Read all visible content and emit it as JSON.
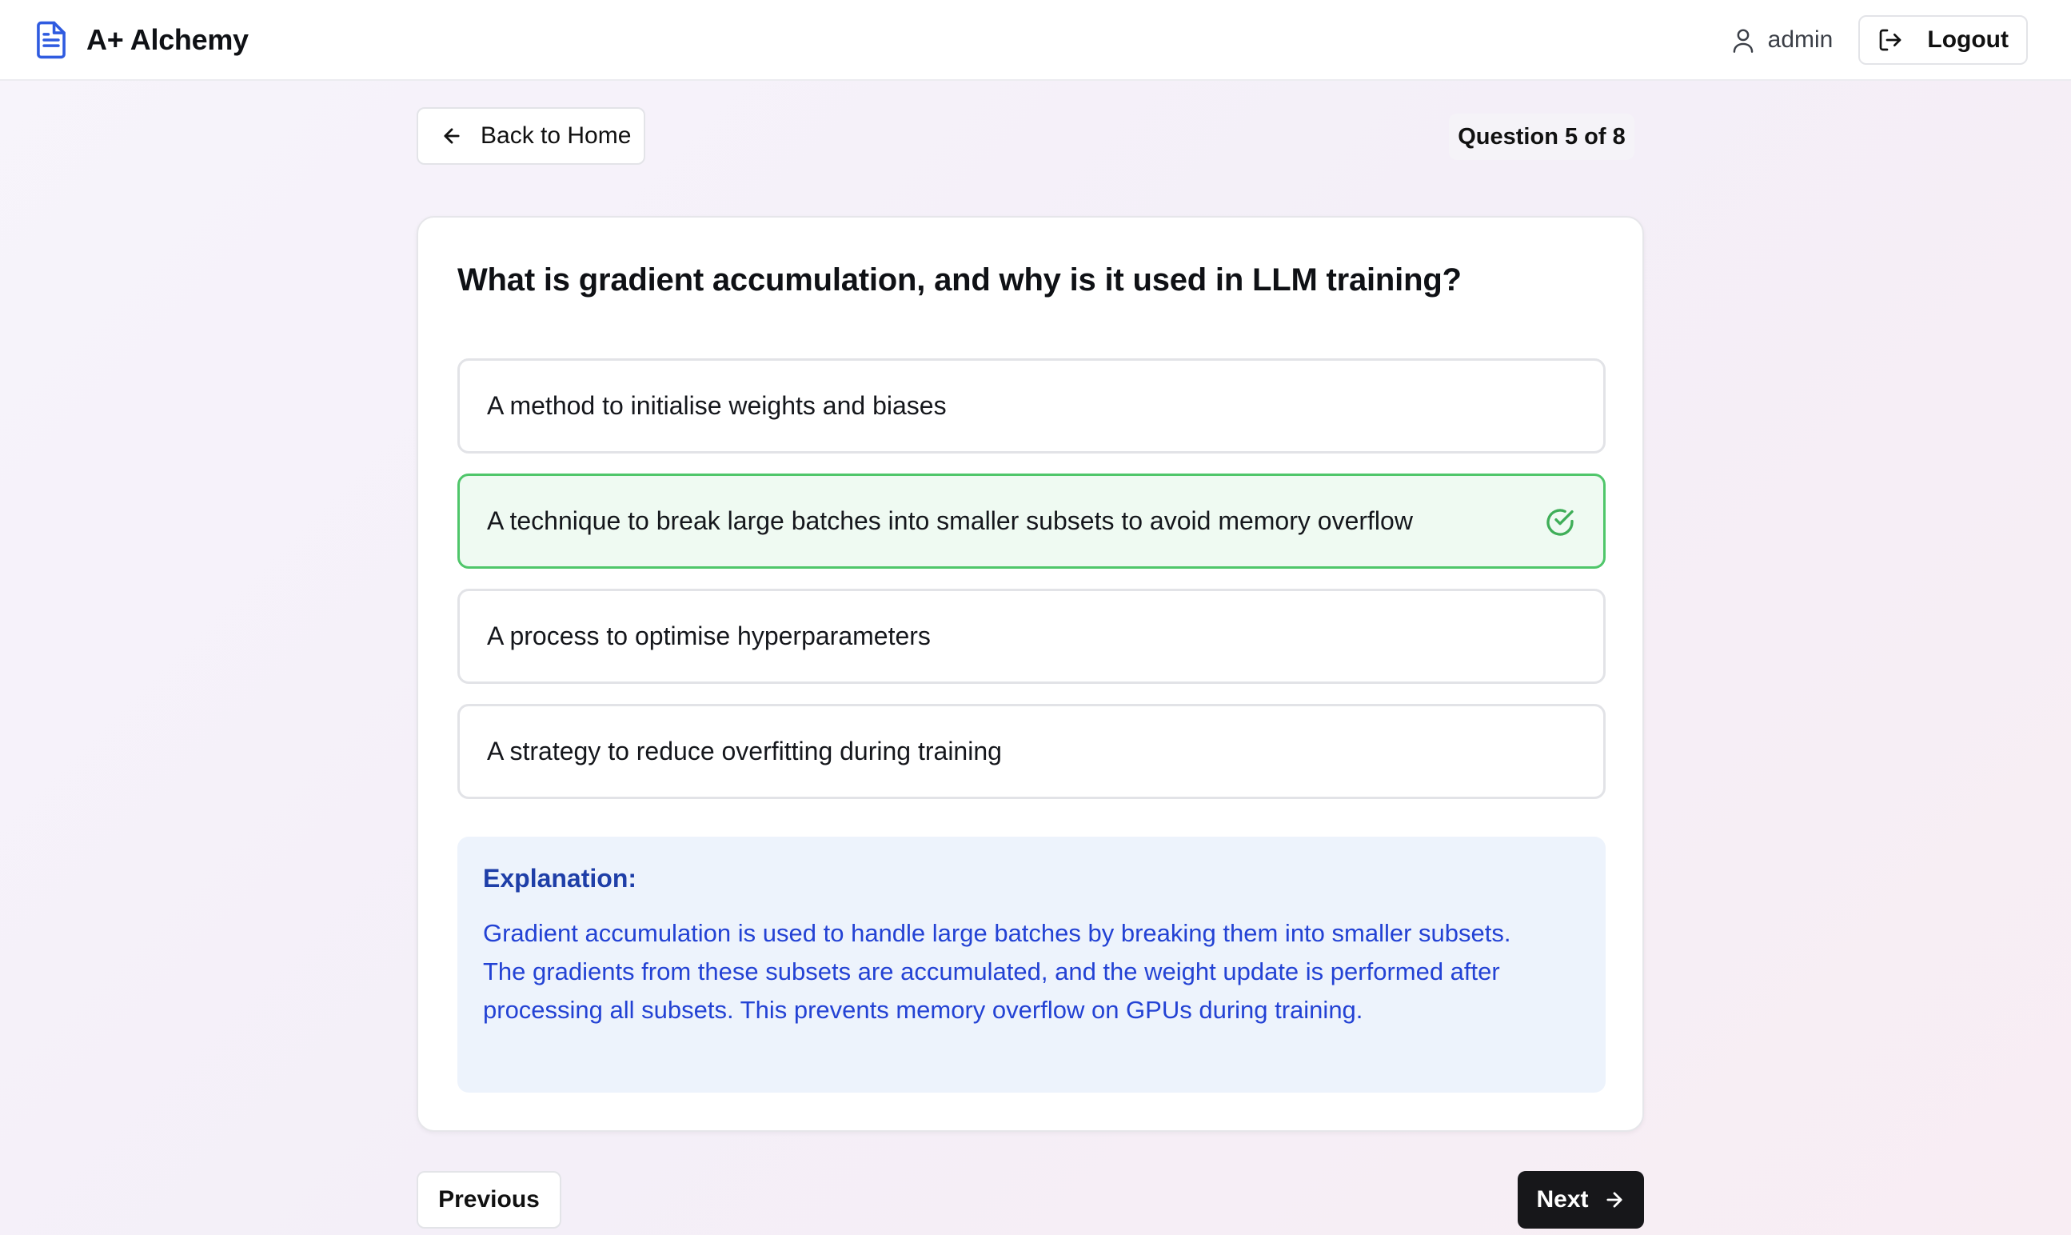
{
  "app": {
    "name": "A+ Alchemy"
  },
  "header": {
    "user": "admin",
    "logout_label": "Logout"
  },
  "nav": {
    "back_label": "Back to Home",
    "progress": "Question 5 of 8"
  },
  "quiz": {
    "question": "What is gradient accumulation, and why is it used in LLM training?",
    "options": [
      {
        "text": "A method to initialise weights and biases",
        "state": "default"
      },
      {
        "text": "A technique to break large batches into smaller subsets to avoid memory overflow",
        "state": "correct"
      },
      {
        "text": "A process to optimise hyperparameters",
        "state": "default"
      },
      {
        "text": "A strategy to reduce overfitting during training",
        "state": "default"
      }
    ],
    "explanation": {
      "title": "Explanation:",
      "text": "Gradient accumulation is used to handle large batches by breaking them into smaller subsets. The gradients from these subsets are accumulated, and the weight update is performed after processing all subsets. This prevents memory overflow on GPUs during training."
    }
  },
  "footer": {
    "previous_label": "Previous",
    "next_label": "Next"
  },
  "icons": {
    "brand": "document-icon",
    "user": "user-icon",
    "logout": "logout-icon",
    "back": "arrow-left-icon",
    "correct": "check-circle-icon",
    "next": "arrow-right-icon"
  },
  "colors": {
    "accent": "#2f5be0",
    "correct_border": "#4fc66a",
    "correct_bg": "#effaf2",
    "explanation_bg": "#edf3fc",
    "explanation_text": "#2342d4"
  }
}
